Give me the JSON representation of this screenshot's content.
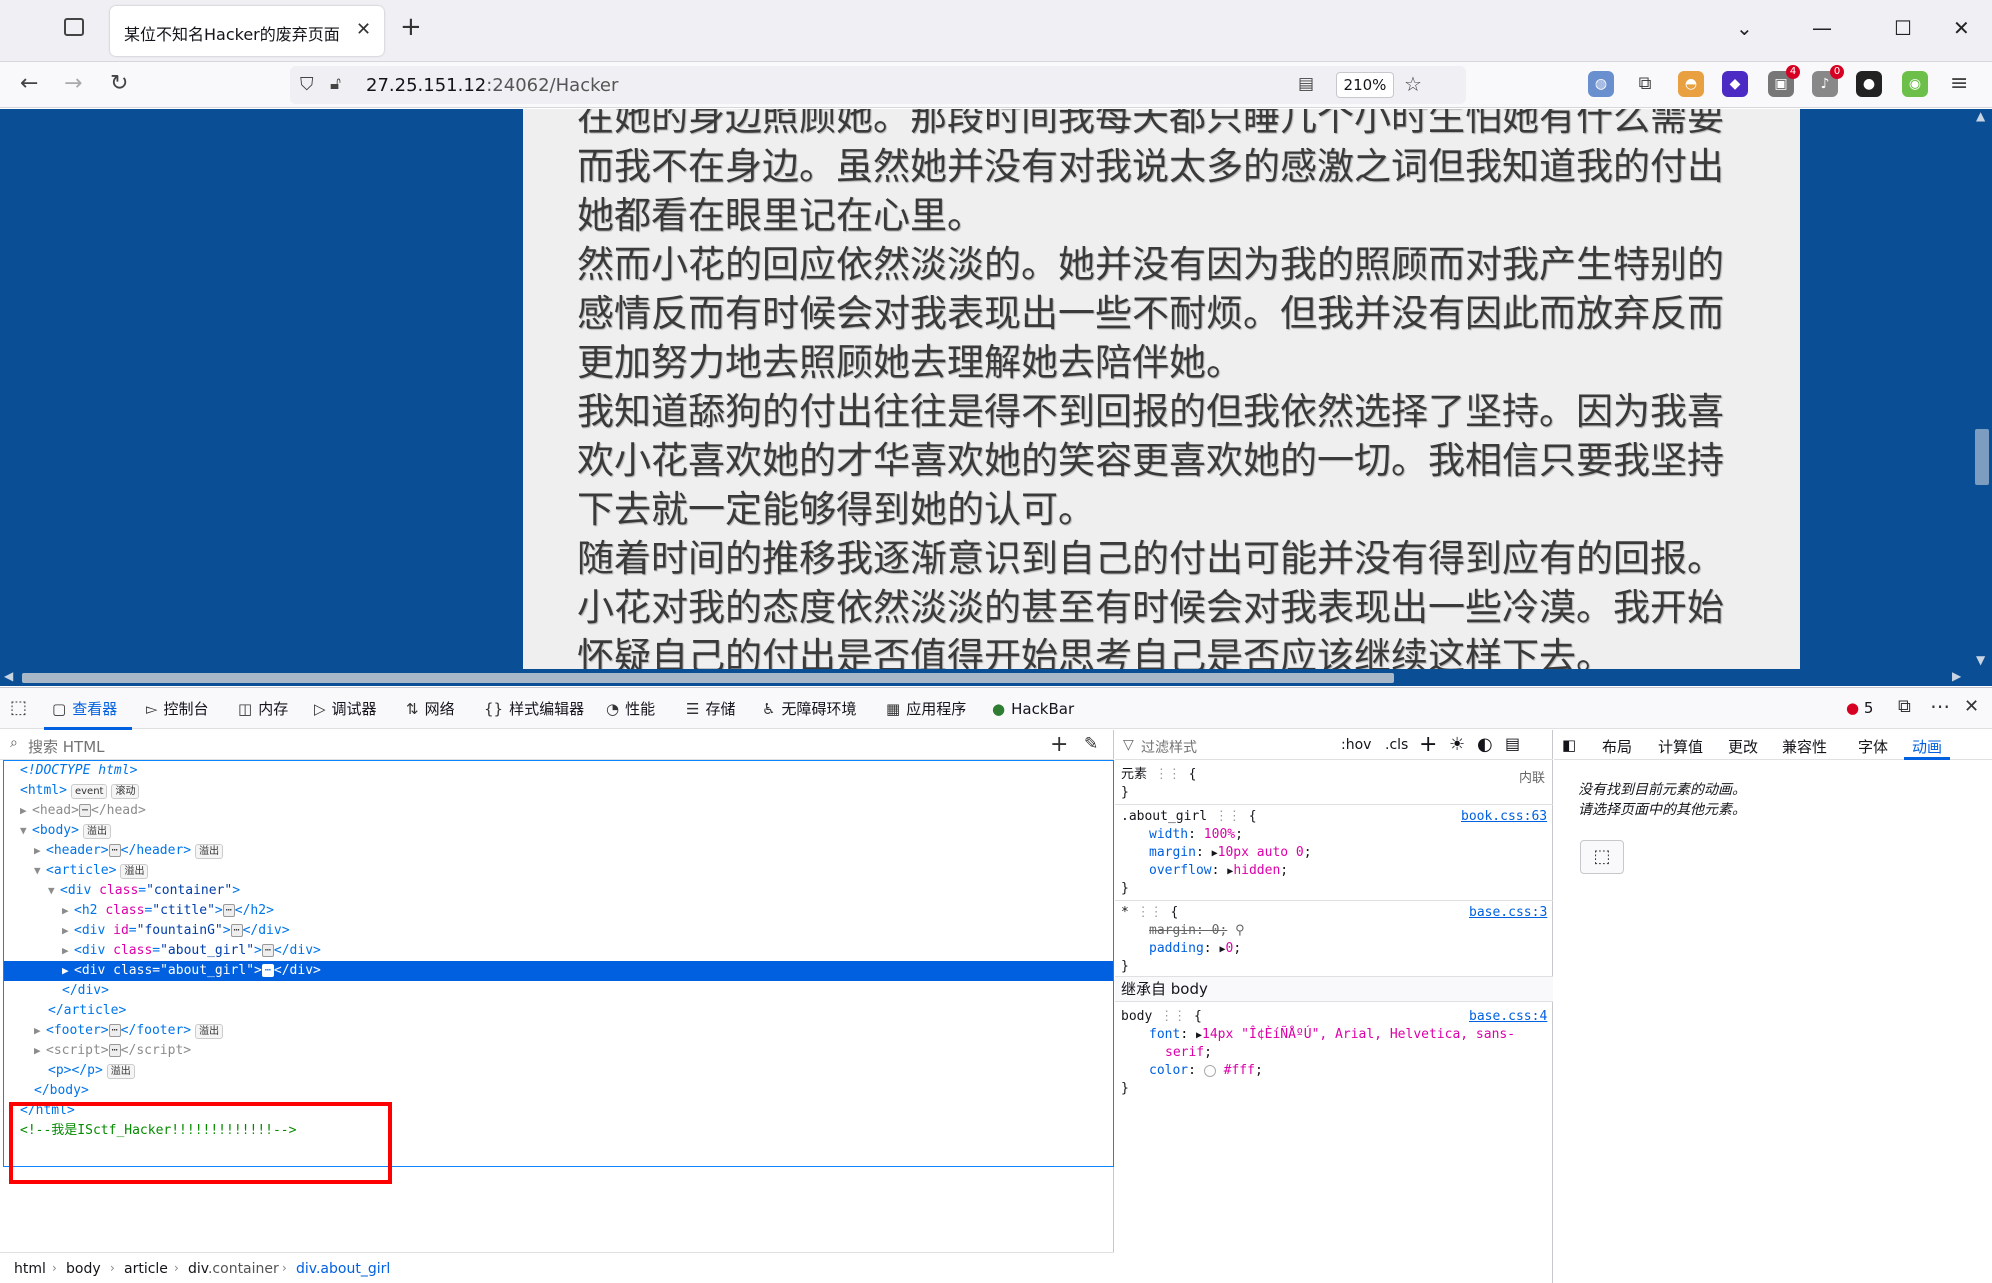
{
  "browser": {
    "tab_title": "某位不知名Hacker的废弃页面",
    "url_host": "27.25.151.12",
    "url_rest": ":24062/Hacker",
    "zoom": "210%",
    "extension_badges": {
      "ext4": "4",
      "ext5": "0"
    }
  },
  "page": {
    "paragraphs": [
      "在她的身边照顾她。那段时间我每天都只睡几个小时生怕她有什么需要而我不在身边。虽然她并没有对我说太多的感激之词但我知道我的付出她都看在眼里记在心里。",
      "然而小花的回应依然淡淡的。她并没有因为我的照顾而对我产生特别的感情反而有时候会对我表现出一些不耐烦。但我并没有因此而放弃反而更加努力地去照顾她去理解她去陪伴她。",
      "我知道舔狗的付出往往是得不到回报的但我依然选择了坚持。因为我喜欢小花喜欢她的才华喜欢她的笑容更喜欢她的一切。我相信只要我坚持下去就一定能够得到她的认可。",
      "随着时间的推移我逐渐意识到自己的付出可能并没有得到应有的回报。小花对我的态度依然淡淡的甚至有时候会对我表现出一些冷漠。我开始怀疑自己的付出是否值得开始思考自己是否应该继续这样下去。"
    ]
  },
  "devtools": {
    "tabs": [
      "查看器",
      "控制台",
      "内存",
      "调试器",
      "网络",
      "样式编辑器",
      "性能",
      "存储",
      "无障碍环境",
      "应用程序",
      "HackBar"
    ],
    "error_count": "5",
    "search_placeholder": "搜索 HTML",
    "filter_styles_placeholder": "过滤样式",
    "hov": ":hov",
    "cls": ".cls",
    "badges": {
      "event": "event",
      "scroll": "滚动",
      "overflow": "溢出"
    },
    "tree": {
      "doctype": "<!DOCTYPE html>",
      "html": "html",
      "head": "head",
      "body": "body",
      "header": "header",
      "article": "article",
      "div": "div",
      "h2": "h2",
      "footer": "footer",
      "script": "script",
      "p": "p",
      "class_attr": "class",
      "id_attr": "id",
      "container_val": "\"container\"",
      "ctitle_val": "\"ctitle\"",
      "fountain_val": "\"fountainG\"",
      "about_val": "\"about_girl\"",
      "comment": "<!--我是ISctf_Hacker!!!!!!!!!!!!!-->"
    },
    "breadcrumbs": {
      "html": "html",
      "body": "body",
      "article": "article",
      "div": "div",
      "container": ".container",
      "about": ".about_girl"
    },
    "rules": {
      "element_label": "元素",
      "inline_label": "内联",
      "about_selector": ".about_girl",
      "about_source": "book.css:63",
      "width_prop": "width",
      "width_val": "100%",
      "margin_prop": "margin",
      "margin_val": "10px auto 0",
      "overflow_prop": "overflow",
      "overflow_val": "hidden",
      "star_selector": "*",
      "star_source": "base.css:3",
      "star_margin": "margin: 0;",
      "padding_prop": "padding",
      "padding_val": "0",
      "inherited_from": "继承自 body",
      "body_selector": "body",
      "body_source": "base.css:4",
      "font_prop": "font",
      "font_val_1": "14px \"Î¢ÈíÑÅºÚ\", Arial, Helvetica, sans-",
      "font_val_2": "serif",
      "color_prop": "color",
      "color_val": "#fff"
    },
    "right_tabs": [
      "布局",
      "计算值",
      "更改",
      "兼容性",
      "字体",
      "动画"
    ],
    "animation_empty_line1": "没有找到目前元素的动画。",
    "animation_empty_line2": "请选择页面中的其他元素。",
    "accent": "#0060df"
  }
}
